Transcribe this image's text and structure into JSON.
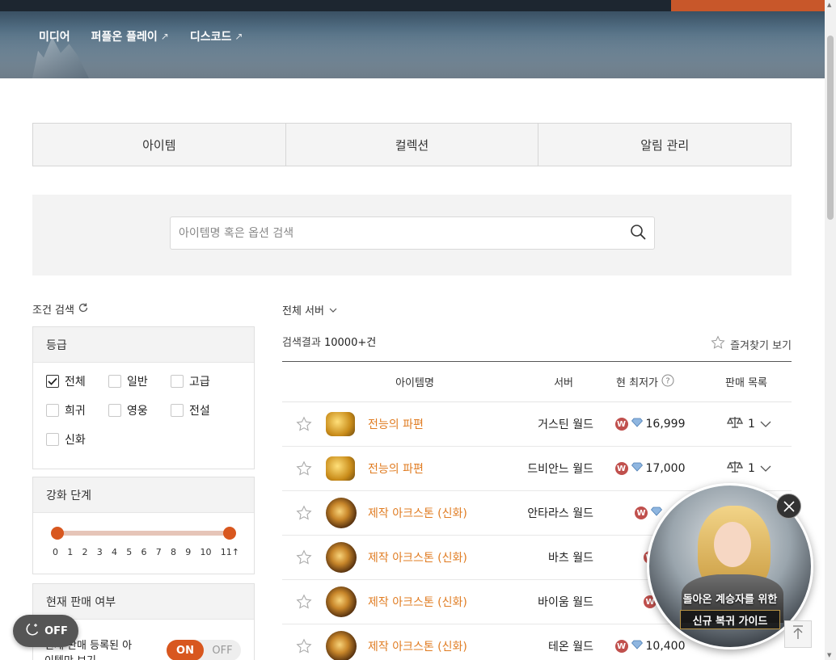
{
  "nav": [
    {
      "label": "미디어",
      "external": false
    },
    {
      "label": "퍼플온 플레이",
      "external": true
    },
    {
      "label": "디스코드",
      "external": true
    }
  ],
  "tabs": [
    "아이템",
    "컬렉션",
    "알림 관리"
  ],
  "search": {
    "placeholder": "아이템명 혹은 옵션 검색",
    "value": ""
  },
  "filter": {
    "title": "조건 검색",
    "grade": {
      "heading": "등급",
      "options": [
        {
          "label": "전체",
          "checked": true
        },
        {
          "label": "일반",
          "checked": false
        },
        {
          "label": "고급",
          "checked": false
        },
        {
          "label": "희귀",
          "checked": false
        },
        {
          "label": "영웅",
          "checked": false
        },
        {
          "label": "전설",
          "checked": false
        },
        {
          "label": "신화",
          "checked": false
        }
      ]
    },
    "enhance": {
      "heading": "강화 단계",
      "ticks": [
        "0",
        "1",
        "2",
        "3",
        "4",
        "5",
        "6",
        "7",
        "8",
        "9",
        "10",
        "11↑"
      ],
      "range": [
        0,
        11
      ]
    },
    "sale": {
      "heading": "현재 판매 여부",
      "label": "현재 판매 등록된 아이템만 보기",
      "on_label": "ON",
      "off_label": "OFF",
      "value": "ON"
    }
  },
  "darkmode": {
    "label": "OFF"
  },
  "results": {
    "server_select": "전체 서버",
    "count_prefix": "검색결과",
    "count": "10000+건",
    "favorites_label": "즐겨찾기 보기",
    "columns": {
      "name": "아이템명",
      "server": "서버",
      "price": "현 최저가",
      "list": "판매 목록"
    },
    "rows": [
      {
        "icon": "gold-pile-icon",
        "name": "전능의 파편",
        "server": "거스틴 월드",
        "price": "16,999",
        "count": "1"
      },
      {
        "icon": "gold-pile-icon",
        "name": "전능의 파편",
        "server": "드비안느 월드",
        "price": "17,000",
        "count": "1"
      },
      {
        "icon": "arkstone-icon",
        "name": "제작 아크스톤 (신화)",
        "server": "안타라스 월드",
        "price": "",
        "count": ""
      },
      {
        "icon": "arkstone-icon",
        "name": "제작 아크스톤 (신화)",
        "server": "바츠 월드",
        "price": "",
        "count": ""
      },
      {
        "icon": "arkstone-icon",
        "name": "제작 아크스톤 (신화)",
        "server": "바이움 월드",
        "price": "",
        "count": ""
      },
      {
        "icon": "arkstone-icon",
        "name": "제작 아크스톤 (신화)",
        "server": "테온 월드",
        "price": "10,400",
        "count": ""
      }
    ]
  },
  "popup": {
    "line1": "돌아온 계승자를 위한",
    "line2": "신규 복귀 가이드"
  },
  "colors": {
    "accent": "#d8571f",
    "item_name": "#e07c22",
    "coin": "#c0504d"
  }
}
